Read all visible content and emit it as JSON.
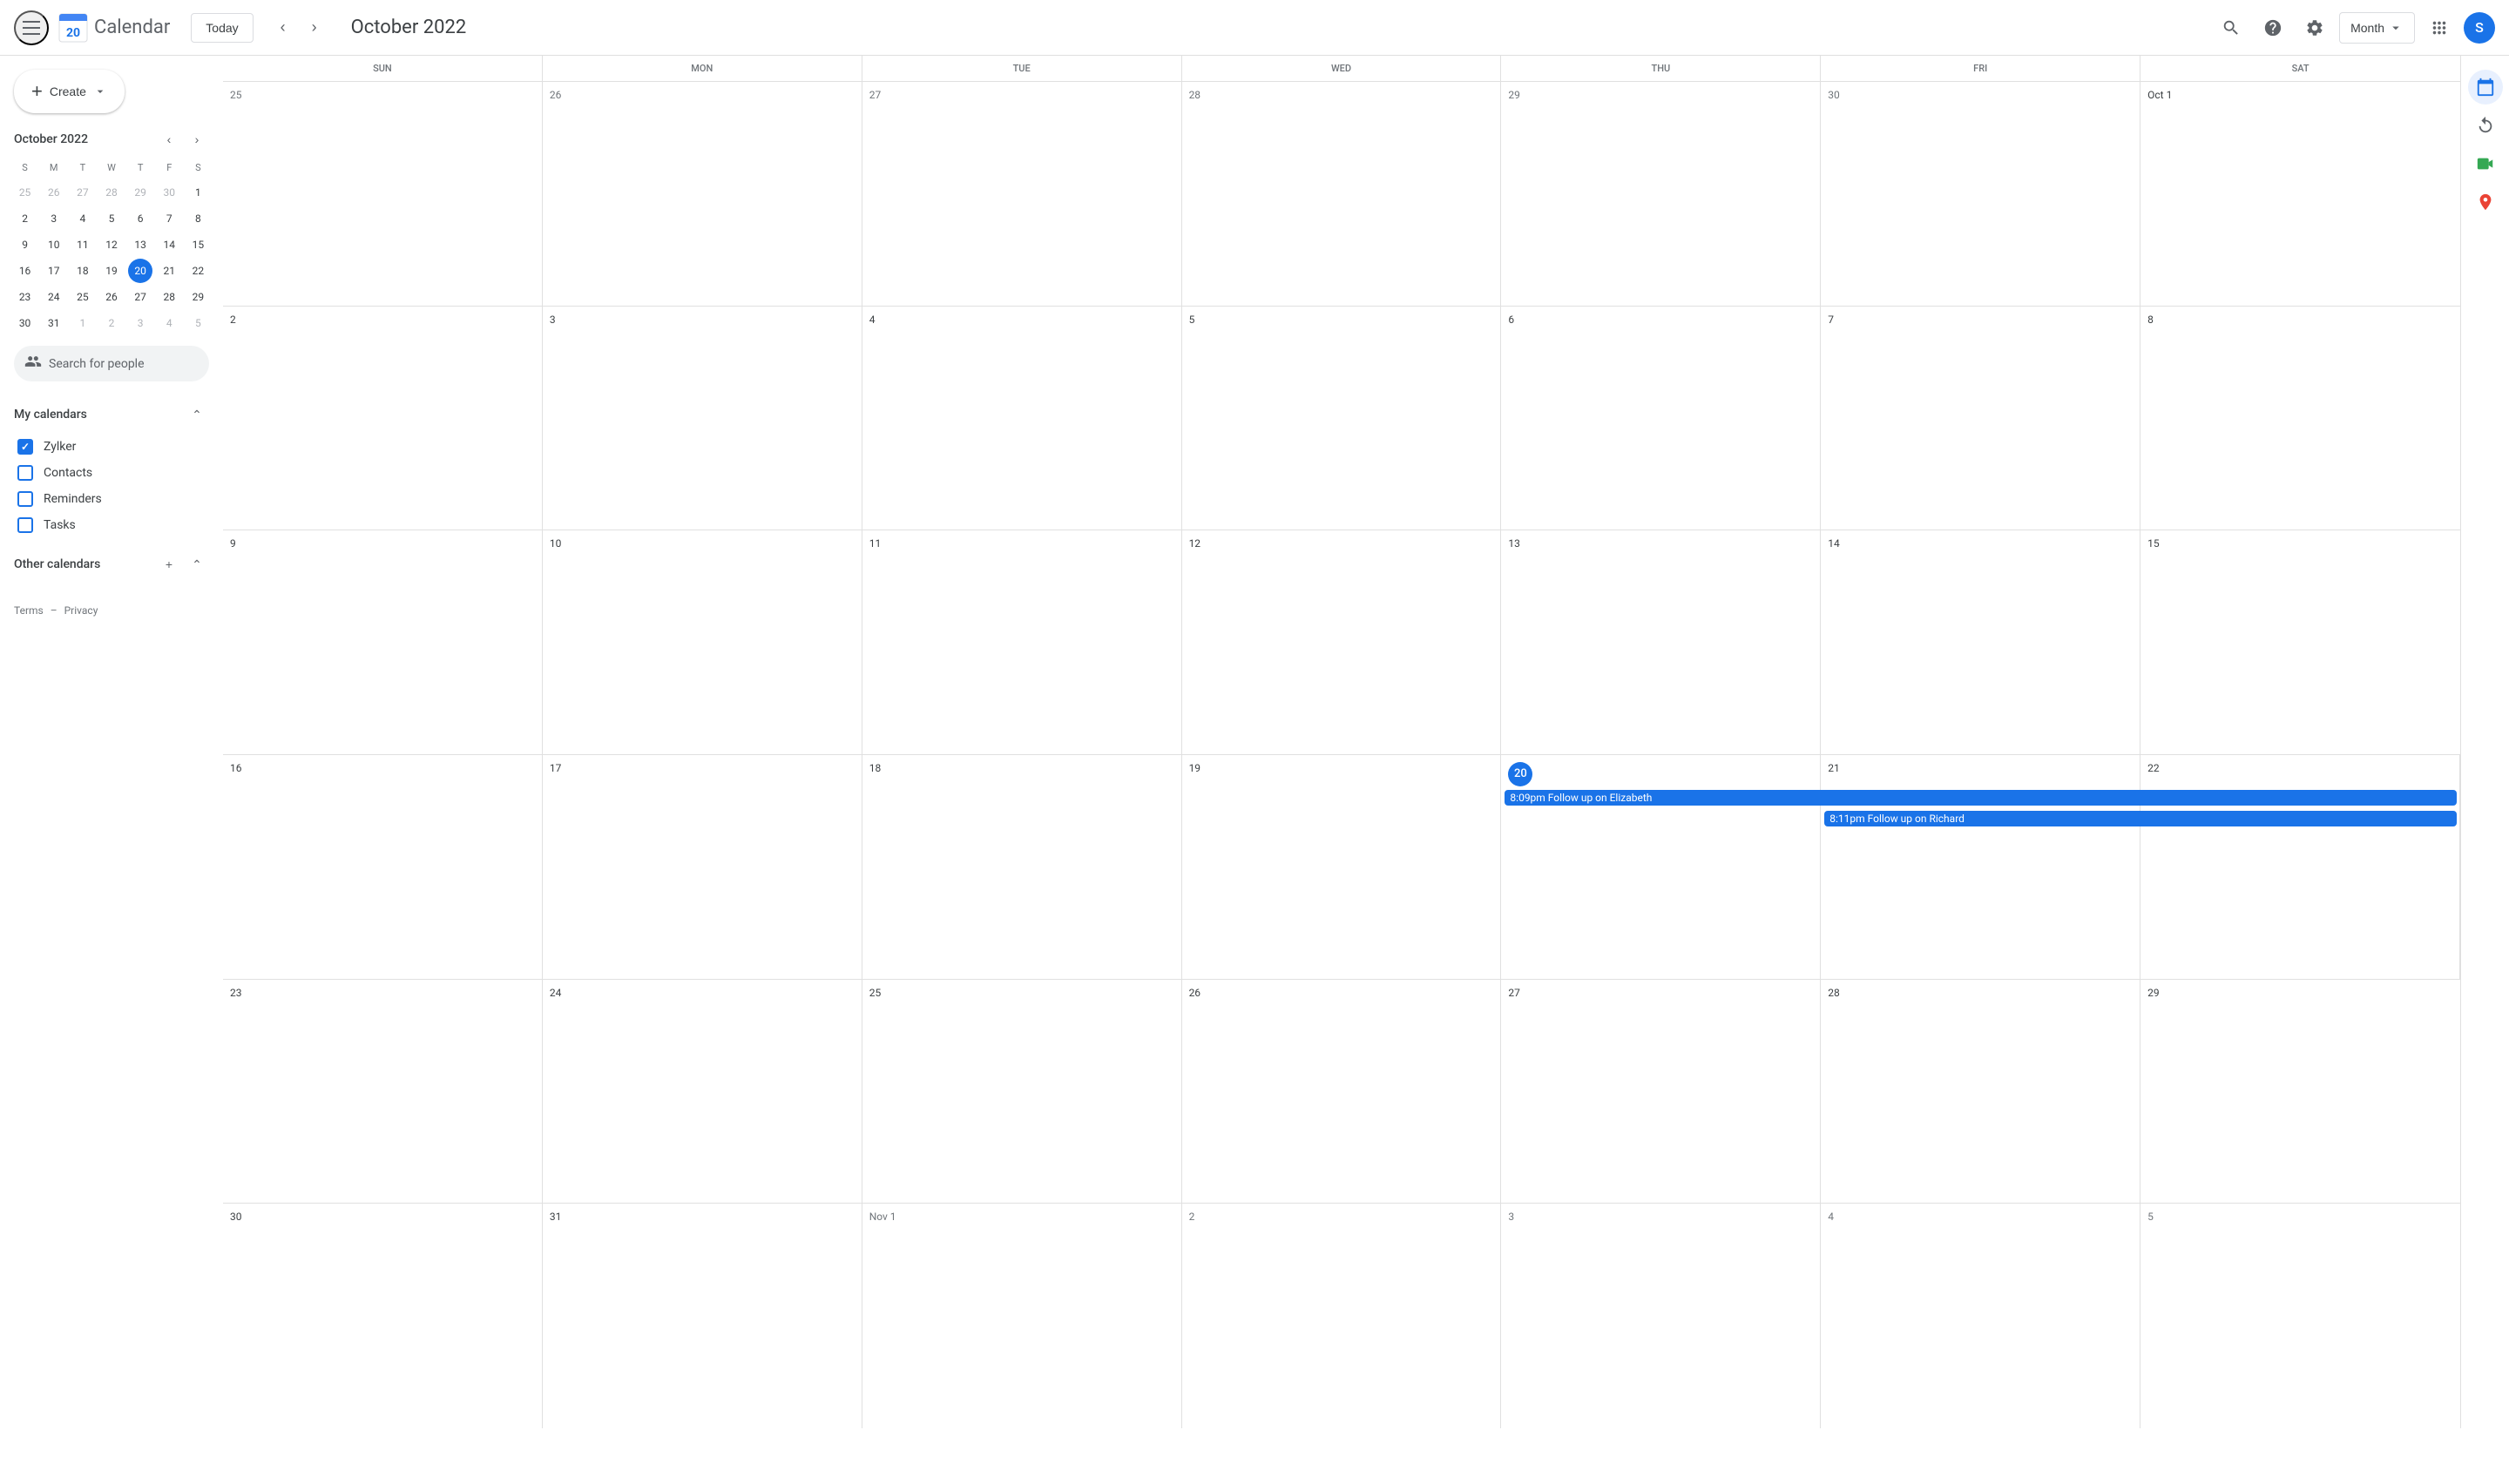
{
  "header": {
    "today_label": "Today",
    "month_title": "October 2022",
    "view_selector": "Month",
    "app_name": "Calendar",
    "user_initial": "S"
  },
  "sidebar": {
    "create_label": "Create",
    "mini_cal": {
      "title": "October 2022",
      "day_names": [
        "S",
        "M",
        "T",
        "W",
        "T",
        "F",
        "S"
      ],
      "weeks": [
        [
          {
            "date": "25",
            "other": true
          },
          {
            "date": "26",
            "other": true
          },
          {
            "date": "27",
            "other": true
          },
          {
            "date": "28",
            "other": true
          },
          {
            "date": "29",
            "other": true
          },
          {
            "date": "30",
            "other": true
          },
          {
            "date": "1",
            "other": false
          }
        ],
        [
          {
            "date": "2",
            "other": false
          },
          {
            "date": "3",
            "other": false
          },
          {
            "date": "4",
            "other": false
          },
          {
            "date": "5",
            "other": false
          },
          {
            "date": "6",
            "other": false
          },
          {
            "date": "7",
            "other": false
          },
          {
            "date": "8",
            "other": false
          }
        ],
        [
          {
            "date": "9",
            "other": false
          },
          {
            "date": "10",
            "other": false
          },
          {
            "date": "11",
            "other": false
          },
          {
            "date": "12",
            "other": false
          },
          {
            "date": "13",
            "other": false
          },
          {
            "date": "14",
            "other": false
          },
          {
            "date": "15",
            "other": false
          }
        ],
        [
          {
            "date": "16",
            "other": false
          },
          {
            "date": "17",
            "other": false
          },
          {
            "date": "18",
            "other": false
          },
          {
            "date": "19",
            "other": false
          },
          {
            "date": "20",
            "other": false,
            "today": true
          },
          {
            "date": "21",
            "other": false
          },
          {
            "date": "22",
            "other": false
          }
        ],
        [
          {
            "date": "23",
            "other": false
          },
          {
            "date": "24",
            "other": false
          },
          {
            "date": "25",
            "other": false
          },
          {
            "date": "26",
            "other": false
          },
          {
            "date": "27",
            "other": false
          },
          {
            "date": "28",
            "other": false
          },
          {
            "date": "29",
            "other": false
          }
        ],
        [
          {
            "date": "30",
            "other": false
          },
          {
            "date": "31",
            "other": false
          },
          {
            "date": "1",
            "other": true
          },
          {
            "date": "2",
            "other": true
          },
          {
            "date": "3",
            "other": true
          },
          {
            "date": "4",
            "other": true
          },
          {
            "date": "5",
            "other": true
          }
        ]
      ]
    },
    "search_people_placeholder": "Search for people",
    "my_calendars_label": "My calendars",
    "my_calendars": [
      {
        "name": "Zylker",
        "color": "#1a73e8",
        "checked": true
      },
      {
        "name": "Contacts",
        "color": "#1a73e8",
        "checked": false
      },
      {
        "name": "Reminders",
        "color": "#1a73e8",
        "checked": false
      },
      {
        "name": "Tasks",
        "color": "#1a73e8",
        "checked": false
      }
    ],
    "other_calendars_label": "Other calendars",
    "footer": {
      "terms": "Terms",
      "separator": "–",
      "privacy": "Privacy"
    }
  },
  "calendar": {
    "day_headers": [
      {
        "short": "SUN",
        "full": "Sunday"
      },
      {
        "short": "MON",
        "full": "Monday"
      },
      {
        "short": "TUE",
        "full": "Tuesday"
      },
      {
        "short": "WED",
        "full": "Wednesday"
      },
      {
        "short": "THU",
        "full": "Thursday"
      },
      {
        "short": "FRI",
        "full": "Friday"
      },
      {
        "short": "SAT",
        "full": "Saturday"
      }
    ],
    "weeks": [
      {
        "cells": [
          {
            "date": "25",
            "month": "sep",
            "current": false
          },
          {
            "date": "26",
            "month": "sep",
            "current": false
          },
          {
            "date": "27",
            "month": "sep",
            "current": false
          },
          {
            "date": "28",
            "month": "sep",
            "current": false
          },
          {
            "date": "29",
            "month": "sep",
            "current": false
          },
          {
            "date": "30",
            "month": "sep",
            "current": false
          },
          {
            "date": "Oct 1",
            "month": "oct",
            "current": true
          }
        ]
      },
      {
        "cells": [
          {
            "date": "2",
            "month": "oct",
            "current": true
          },
          {
            "date": "3",
            "month": "oct",
            "current": true
          },
          {
            "date": "4",
            "month": "oct",
            "current": true
          },
          {
            "date": "5",
            "month": "oct",
            "current": true
          },
          {
            "date": "6",
            "month": "oct",
            "current": true
          },
          {
            "date": "7",
            "month": "oct",
            "current": true
          },
          {
            "date": "8",
            "month": "oct",
            "current": true
          }
        ]
      },
      {
        "cells": [
          {
            "date": "9",
            "month": "oct",
            "current": true
          },
          {
            "date": "10",
            "month": "oct",
            "current": true
          },
          {
            "date": "11",
            "month": "oct",
            "current": true
          },
          {
            "date": "12",
            "month": "oct",
            "current": true
          },
          {
            "date": "13",
            "month": "oct",
            "current": true
          },
          {
            "date": "14",
            "month": "oct",
            "current": true
          },
          {
            "date": "15",
            "month": "oct",
            "current": true
          }
        ]
      },
      {
        "cells": [
          {
            "date": "16",
            "month": "oct",
            "current": true
          },
          {
            "date": "17",
            "month": "oct",
            "current": true
          },
          {
            "date": "18",
            "month": "oct",
            "current": true
          },
          {
            "date": "19",
            "month": "oct",
            "current": true
          },
          {
            "date": "20",
            "month": "oct",
            "current": true,
            "today": true
          },
          {
            "date": "21",
            "month": "oct",
            "current": true
          },
          {
            "date": "22",
            "month": "oct",
            "current": true
          }
        ],
        "events": [
          {
            "day": 4,
            "span": 2,
            "time": "8:09pm",
            "text": "Follow up on Elizabeth",
            "color": "blue"
          },
          {
            "day": 5,
            "span": 2,
            "time": "8:11pm",
            "text": "Follow up on Richard",
            "color": "blue"
          }
        ]
      },
      {
        "cells": [
          {
            "date": "23",
            "month": "oct",
            "current": true
          },
          {
            "date": "24",
            "month": "oct",
            "current": true
          },
          {
            "date": "25",
            "month": "oct",
            "current": true
          },
          {
            "date": "26",
            "month": "oct",
            "current": true
          },
          {
            "date": "27",
            "month": "oct",
            "current": true
          },
          {
            "date": "28",
            "month": "oct",
            "current": true
          },
          {
            "date": "29",
            "month": "oct",
            "current": true
          }
        ]
      },
      {
        "cells": [
          {
            "date": "30",
            "month": "oct",
            "current": true
          },
          {
            "date": "31",
            "month": "oct",
            "current": true
          },
          {
            "date": "Nov 1",
            "month": "nov",
            "current": false
          },
          {
            "date": "2",
            "month": "nov",
            "current": false
          },
          {
            "date": "3",
            "month": "nov",
            "current": false
          },
          {
            "date": "4",
            "month": "nov",
            "current": false
          },
          {
            "date": "5",
            "month": "nov",
            "current": false
          }
        ]
      }
    ]
  },
  "right_sidebar": {
    "icons": [
      "calendar-icon",
      "refresh-icon",
      "meet-icon",
      "maps-icon"
    ]
  },
  "events": {
    "event1": {
      "time": "8:09pm",
      "text": "Follow up on Elizabeth"
    },
    "event2": {
      "time": "8:11pm",
      "text": "Follow up on Richard"
    }
  }
}
